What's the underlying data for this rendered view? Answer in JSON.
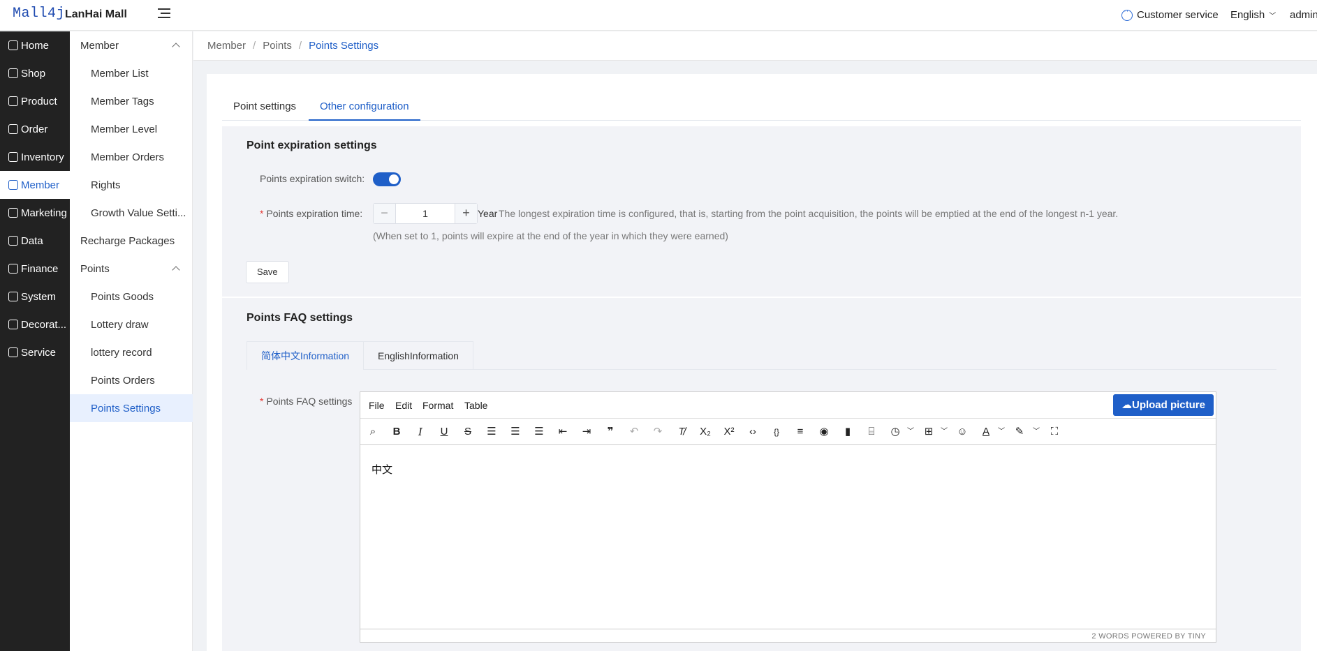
{
  "header": {
    "logo": "Mall4j",
    "brand": "LanHai Mall",
    "customer_service": "Customer service",
    "language": "English",
    "user": "admin"
  },
  "nav": {
    "items": [
      {
        "label": "Home",
        "icon": "home-icon"
      },
      {
        "label": "Shop",
        "icon": "shop-icon"
      },
      {
        "label": "Product",
        "icon": "product-icon"
      },
      {
        "label": "Order",
        "icon": "order-icon"
      },
      {
        "label": "Inventory",
        "icon": "inventory-icon"
      },
      {
        "label": "Member",
        "icon": "member-icon"
      },
      {
        "label": "Marketing",
        "icon": "marketing-icon"
      },
      {
        "label": "Data",
        "icon": "data-icon"
      },
      {
        "label": "Finance",
        "icon": "finance-icon"
      },
      {
        "label": "System",
        "icon": "system-icon"
      },
      {
        "label": "Decorat...",
        "icon": "decorate-icon"
      },
      {
        "label": "Service",
        "icon": "service-icon"
      }
    ],
    "active": "Member"
  },
  "subnav": {
    "member_group": "Member",
    "member_items": [
      "Member List",
      "Member Tags",
      "Member Level",
      "Member Orders",
      "Rights",
      "Growth Value Setti..."
    ],
    "recharge": "Recharge Packages",
    "points_group": "Points",
    "points_items": [
      "Points Goods",
      "Lottery draw",
      "lottery record",
      "Points Orders",
      "Points Settings"
    ],
    "active": "Points Settings"
  },
  "breadcrumb": [
    "Member",
    "Points",
    "Points Settings"
  ],
  "tabs": [
    "Point settings",
    "Other configuration"
  ],
  "active_tab": "Other configuration",
  "expiration": {
    "title": "Point expiration settings",
    "switch_label": "Points expiration switch:",
    "switch_on": true,
    "time_label": "Points expiration time:",
    "time_value": "1",
    "unit": "Year",
    "note": "The longest expiration time is configured, that is, starting from the point acquisition, the points will be emptied at the end of the longest n-1 year.",
    "hint": "(When set to 1, points will expire at the end of the year in which they were earned)",
    "save": "Save"
  },
  "faq": {
    "title": "Points FAQ settings",
    "lang_tabs": [
      "简体中文Information",
      "EnglishInformation"
    ],
    "field_label": "Points FAQ settings",
    "menu": [
      "File",
      "Edit",
      "Format",
      "Table"
    ],
    "upload": "Upload picture",
    "content": "中文",
    "status": "2 WORDS  POWERED BY TINY"
  },
  "colors": {
    "accent": "#1f5fc8",
    "sidebar": "#222222"
  }
}
